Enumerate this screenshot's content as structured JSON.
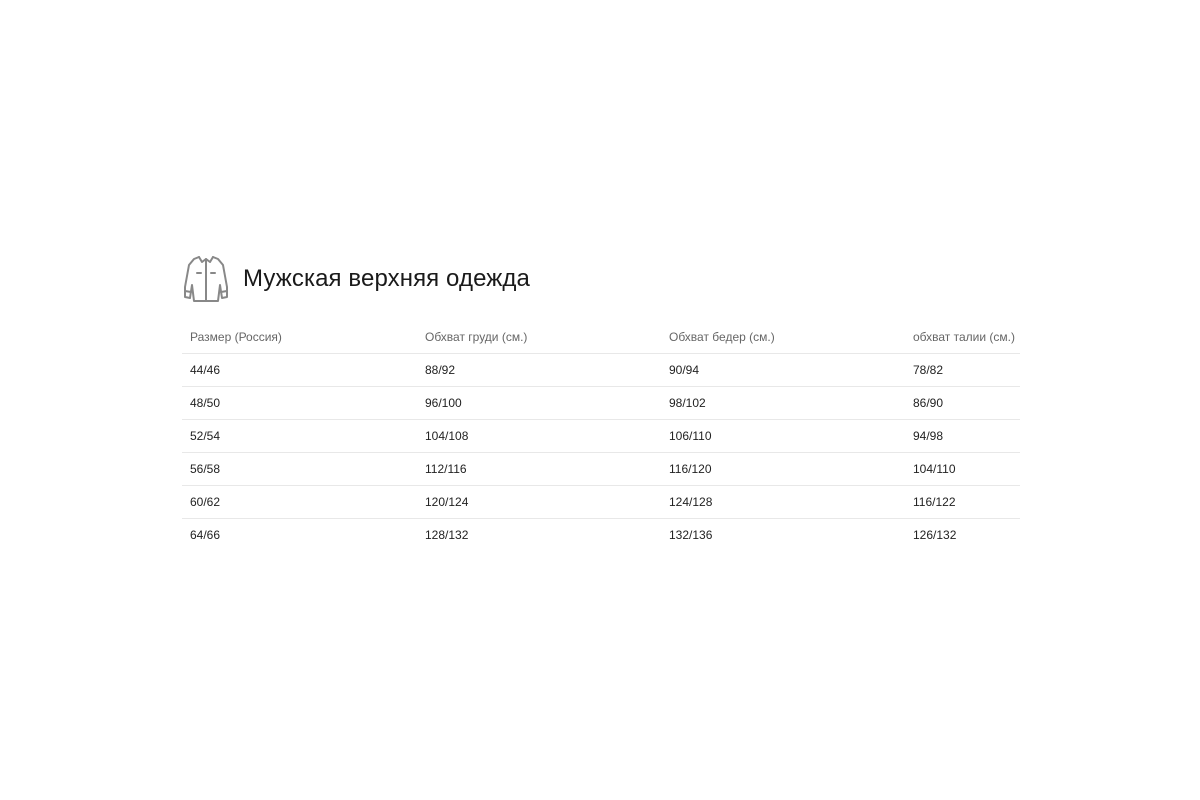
{
  "section": {
    "icon": "jacket-icon",
    "title": "Мужская верхняя одежда"
  },
  "table": {
    "headers": [
      "Размер (Россия)",
      "Обхват груди (см.)",
      "Обхват бедер (см.)",
      "обхват талии (см.)"
    ],
    "rows": [
      [
        "44/46",
        "88/92",
        "90/94",
        "78/82"
      ],
      [
        "48/50",
        "96/100",
        "98/102",
        "86/90"
      ],
      [
        "52/54",
        "104/108",
        "106/110",
        "94/98"
      ],
      [
        "56/58",
        "112/116",
        "116/120",
        "104/110"
      ],
      [
        "60/62",
        "120/124",
        "124/128",
        "116/122"
      ],
      [
        "64/66",
        "128/132",
        "132/136",
        "126/132"
      ]
    ]
  },
  "colors": {
    "icon_stroke": "#888888",
    "divider": "#e8e8e8",
    "header_text": "#666666",
    "cell_text": "#222222"
  }
}
